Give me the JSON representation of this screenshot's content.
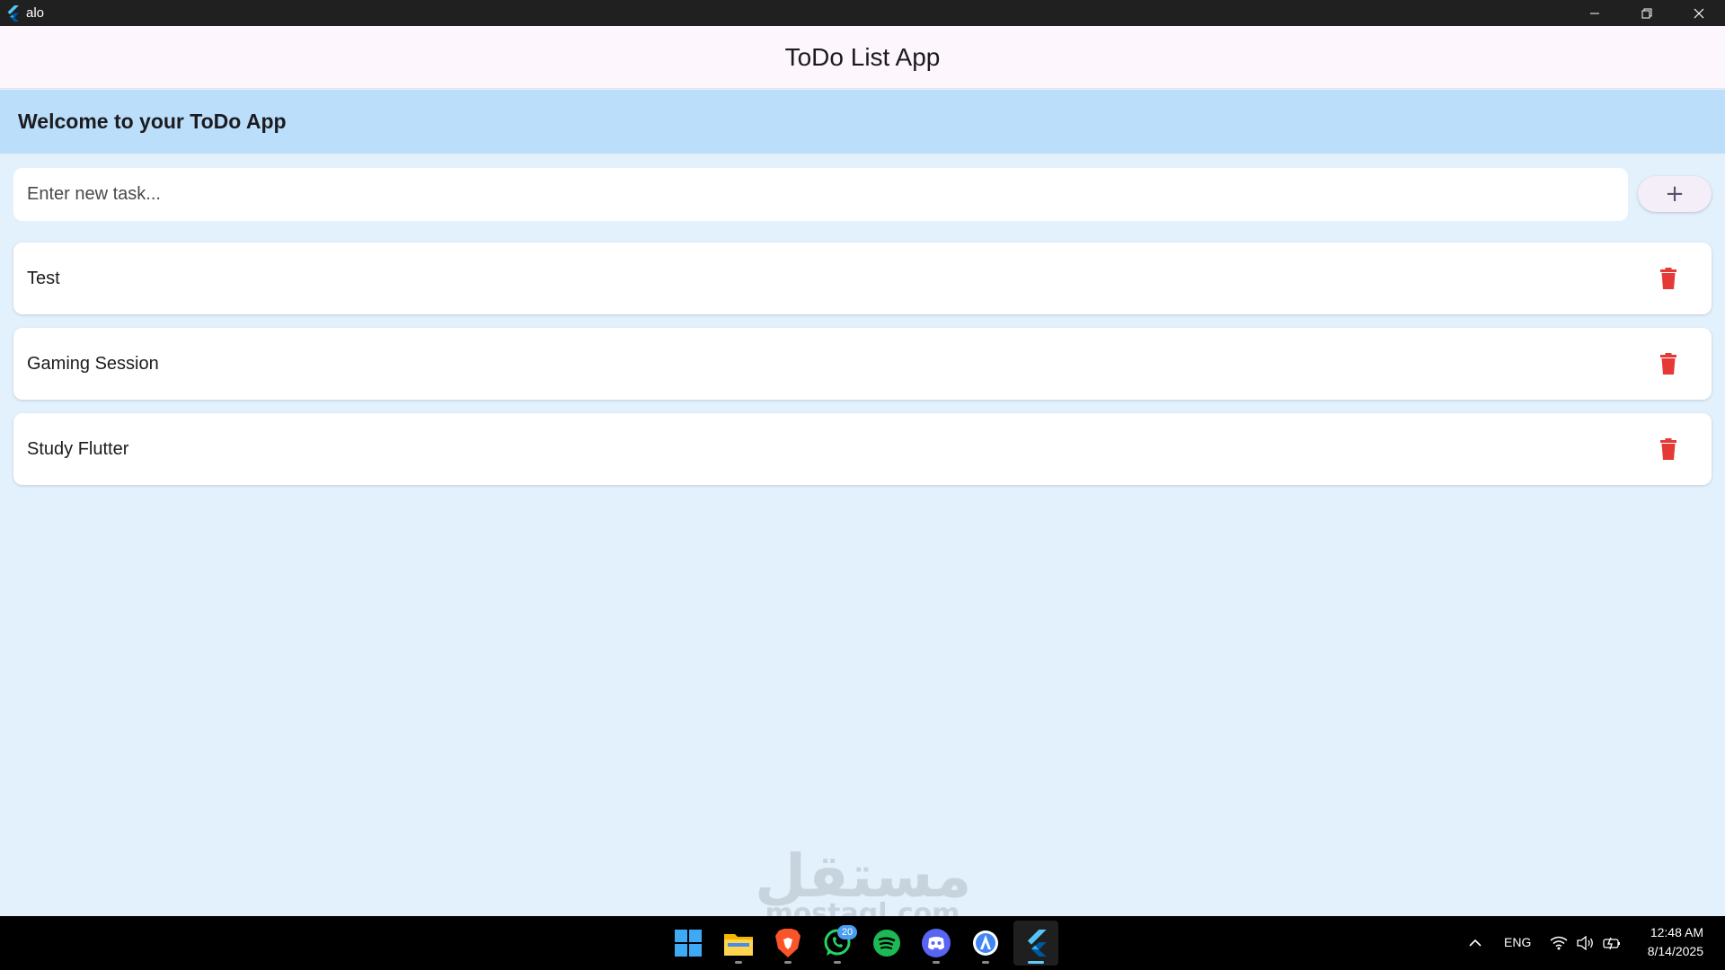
{
  "window": {
    "title": "alo"
  },
  "appbar": {
    "title": "ToDo List App"
  },
  "banner": {
    "welcome": "Welcome to your ToDo App"
  },
  "input": {
    "placeholder": "Enter new task...",
    "value": ""
  },
  "add_button": {
    "label": "+"
  },
  "tasks": [
    {
      "label": "Test"
    },
    {
      "label": "Gaming Session"
    },
    {
      "label": "Study Flutter"
    }
  ],
  "watermark": {
    "arabic": "مستقل",
    "latin": "mostaql.com"
  },
  "taskbar": {
    "apps": [
      "windows-start-icon",
      "file-explorer-icon",
      "brave-browser-icon",
      "whatsapp-icon",
      "spotify-icon",
      "discord-icon",
      "android-studio-icon",
      "flutter-icon"
    ],
    "whatsapp_badge": "20"
  },
  "tray": {
    "language": "ENG",
    "time": "12:48 AM",
    "date": "8/14/2025"
  },
  "colors": {
    "banner": "#bbdefb",
    "background": "#e3f1fc",
    "delete": "#e53935",
    "appbar": "#fdf6fd"
  }
}
